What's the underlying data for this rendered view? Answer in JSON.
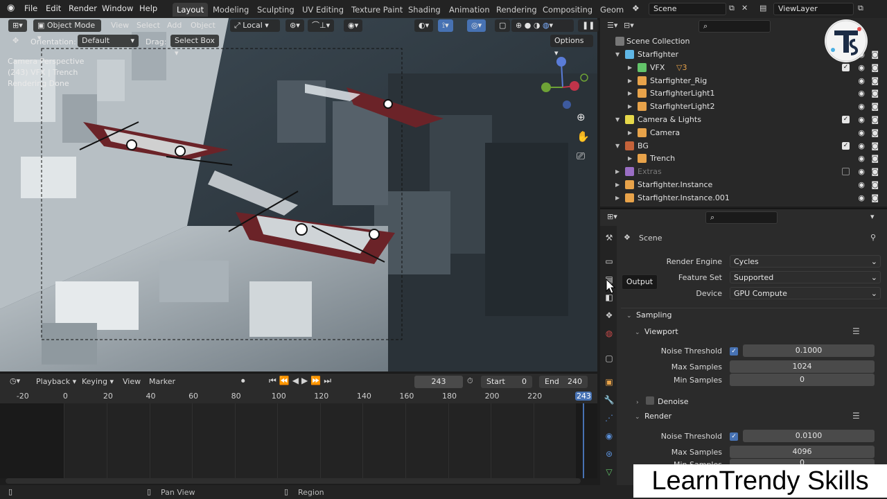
{
  "menu": [
    "File",
    "Edit",
    "Render",
    "Window",
    "Help"
  ],
  "workspaces": [
    "Layout",
    "Modeling",
    "Sculpting",
    "UV Editing",
    "Texture Paint",
    "Shading",
    "Animation",
    "Rendering",
    "Compositing",
    "Geome"
  ],
  "active_workspace": "Layout",
  "scene_name": "Scene",
  "view_layer": "ViewLayer",
  "viewport": {
    "mode": "Object Mode",
    "menus": [
      "View",
      "Select",
      "Add",
      "Object"
    ],
    "transform_space": "Local",
    "orientation_label": "Orientation:",
    "orientation_value": "Default",
    "drag_label": "Drag:",
    "drag_value": "Select Box",
    "options_label": "Options",
    "overlay_lines": [
      "Camera Perspective",
      "(243) VFX | Trench",
      "Rendering Done"
    ]
  },
  "timeline": {
    "playback": "Playback",
    "keying": "Keying",
    "view": "View",
    "marker": "Marker",
    "current_frame": "243",
    "start_label": "Start",
    "start_value": "0",
    "end_label": "End",
    "end_value": "240",
    "ruler": [
      "-20",
      "0",
      "20",
      "40",
      "60",
      "80",
      "100",
      "120",
      "140",
      "160",
      "180",
      "200",
      "220",
      "243"
    ],
    "frame_min": -30,
    "frame_max": 250
  },
  "status": {
    "pan": "Pan View",
    "region": "Region"
  },
  "outliner": {
    "root": "Scene Collection",
    "rows": [
      {
        "name": "Starfighter",
        "depth": 1,
        "expanded": true,
        "icon": "collection-icon",
        "color": "#5fb6e6",
        "checkbox": false
      },
      {
        "name": "VFX",
        "depth": 2,
        "expanded": false,
        "icon": "collection-icon",
        "color": "#63c46a",
        "checkbox": true,
        "extra": "3"
      },
      {
        "name": "Starfighter_Rig",
        "depth": 2,
        "expanded": false,
        "icon": "armature-icon",
        "color": "#e8a34a",
        "checkbox": false
      },
      {
        "name": "StarfighterLight1",
        "depth": 2,
        "expanded": false,
        "icon": "light-icon",
        "color": "#e8a34a",
        "checkbox": false
      },
      {
        "name": "StarfighterLight2",
        "depth": 2,
        "expanded": false,
        "icon": "light-icon",
        "color": "#e8a34a",
        "checkbox": false
      },
      {
        "name": "Camera & Lights",
        "depth": 1,
        "expanded": true,
        "icon": "collection-icon",
        "color": "#e6d84a",
        "checkbox": true
      },
      {
        "name": "Camera",
        "depth": 2,
        "expanded": false,
        "icon": "camera-icon",
        "color": "#e8a34a",
        "checkbox": false
      },
      {
        "name": "BG",
        "depth": 1,
        "expanded": true,
        "icon": "collection-icon",
        "color": "#c4623a",
        "checkbox": true
      },
      {
        "name": "Trench",
        "depth": 2,
        "expanded": false,
        "icon": "mesh-icon",
        "color": "#e8a34a",
        "checkbox": false
      },
      {
        "name": "Extras",
        "depth": 1,
        "expanded": false,
        "icon": "collection-icon",
        "color": "#9a6ec4",
        "checkbox": false,
        "dim": true
      },
      {
        "name": "Starfighter.Instance",
        "depth": 1,
        "expanded": false,
        "icon": "instance-icon",
        "color": "#e8a34a",
        "checkbox": false
      },
      {
        "name": "Starfighter.Instance.001",
        "depth": 1,
        "expanded": false,
        "icon": "instance-icon",
        "color": "#e8a34a",
        "checkbox": false
      }
    ]
  },
  "properties": {
    "context": "Scene",
    "render_engine_label": "Render Engine",
    "render_engine": "Cycles",
    "feature_set_label": "Feature Set",
    "feature_set": "Supported",
    "device_label": "Device",
    "device": "GPU Compute",
    "tooltip": "Output",
    "sampling": "Sampling",
    "viewport_section": "Viewport",
    "vp_noise_label": "Noise Threshold",
    "vp_noise": "0.1000",
    "vp_max_label": "Max Samples",
    "vp_max": "1024",
    "vp_min_label": "Min Samples",
    "vp_min": "0",
    "denoise": "Denoise",
    "render_section": "Render",
    "r_noise_label": "Noise Threshold",
    "r_noise": "0.0100",
    "r_max_label": "Max Samples",
    "r_max": "4096",
    "r_min_label": "Min Samples",
    "r_min": "0"
  },
  "watermark": "LearnTrendy Skills"
}
